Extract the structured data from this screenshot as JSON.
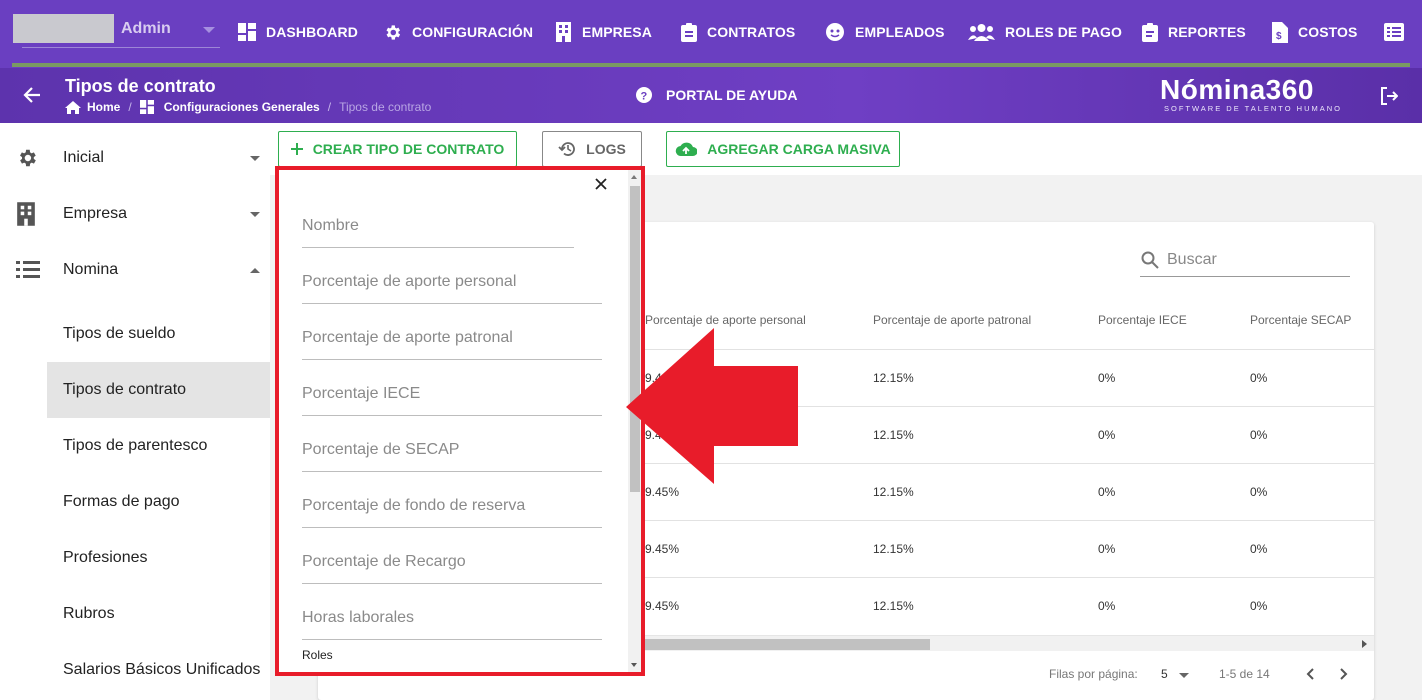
{
  "topbar": {
    "user": "Admin",
    "nav": [
      {
        "label": "DASHBOARD",
        "icon": "dashboard-icon"
      },
      {
        "label": "CONFIGURACIÓN",
        "icon": "gear-icon"
      },
      {
        "label": "EMPRESA",
        "icon": "building-icon"
      },
      {
        "label": "CONTRATOS",
        "icon": "clipboard-icon"
      },
      {
        "label": "EMPLEADOS",
        "icon": "face-icon"
      },
      {
        "label": "ROLES DE PAGO",
        "icon": "people-icon"
      },
      {
        "label": "REPORTES",
        "icon": "clipboard-list-icon"
      },
      {
        "label": "COSTOS",
        "icon": "file-dollar-icon"
      },
      {
        "label": "",
        "icon": "list-box-icon"
      }
    ]
  },
  "header": {
    "title": "Tipos de contrato",
    "breadcrumb": [
      "Home",
      "Configuraciones Generales",
      "Tipos de contrato"
    ],
    "help": "PORTAL DE AYUDA",
    "logo_name": "Nómina360",
    "logo_tagline": "SOFTWARE DE TALENTO HUMANO"
  },
  "sidebar": {
    "items": [
      {
        "label": "Inicial",
        "icon": "gear-icon",
        "expanded": false
      },
      {
        "label": "Empresa",
        "icon": "building-icon",
        "expanded": false
      },
      {
        "label": "Nomina",
        "icon": "list-icon",
        "expanded": true
      }
    ],
    "subitems": [
      {
        "label": "Tipos de sueldo",
        "active": false
      },
      {
        "label": "Tipos de contrato",
        "active": true
      },
      {
        "label": "Tipos de parentesco",
        "active": false
      },
      {
        "label": "Formas de pago",
        "active": false
      },
      {
        "label": "Profesiones",
        "active": false
      },
      {
        "label": "Rubros",
        "active": false,
        "has_caret": true
      },
      {
        "label": "Salarios Básicos Unificados",
        "active": false
      }
    ]
  },
  "toolbar": {
    "create_label": "CREAR TIPO DE CONTRATO",
    "logs_label": "LOGS",
    "bulk_label": "AGREGAR CARGA MASIVA"
  },
  "table": {
    "search_placeholder": "Buscar",
    "columns": [
      "Porcentaje de aporte personal",
      "Porcentaje de aporte patronal",
      "Porcentaje IECE",
      "Porcentaje SECAP"
    ],
    "rows": [
      [
        "9.4",
        "12.15%",
        "0%",
        "0%"
      ],
      [
        "9.4",
        "12.15%",
        "0%",
        "0%"
      ],
      [
        "9.45%",
        "12.15%",
        "0%",
        "0%"
      ],
      [
        "9.45%",
        "12.15%",
        "0%",
        "0%"
      ],
      [
        "9.45%",
        "12.15%",
        "0%",
        "0%"
      ]
    ],
    "rows_per_page_label": "Filas por página:",
    "rows_per_page": "5",
    "range": "1-5 de 14"
  },
  "filter_panel": {
    "fields": [
      "Nombre",
      "Porcentaje de aporte personal",
      "Porcentaje de aporte patronal",
      "Porcentaje IECE",
      "Porcentaje de SECAP",
      "Porcentaje de fondo de reserva",
      "Porcentaje de Recargo",
      "Horas laborales"
    ],
    "roles_label": "Roles"
  },
  "colors": {
    "primary": "#6a3fc1",
    "success": "#2eae4f",
    "highlight": "#e81c2a"
  }
}
